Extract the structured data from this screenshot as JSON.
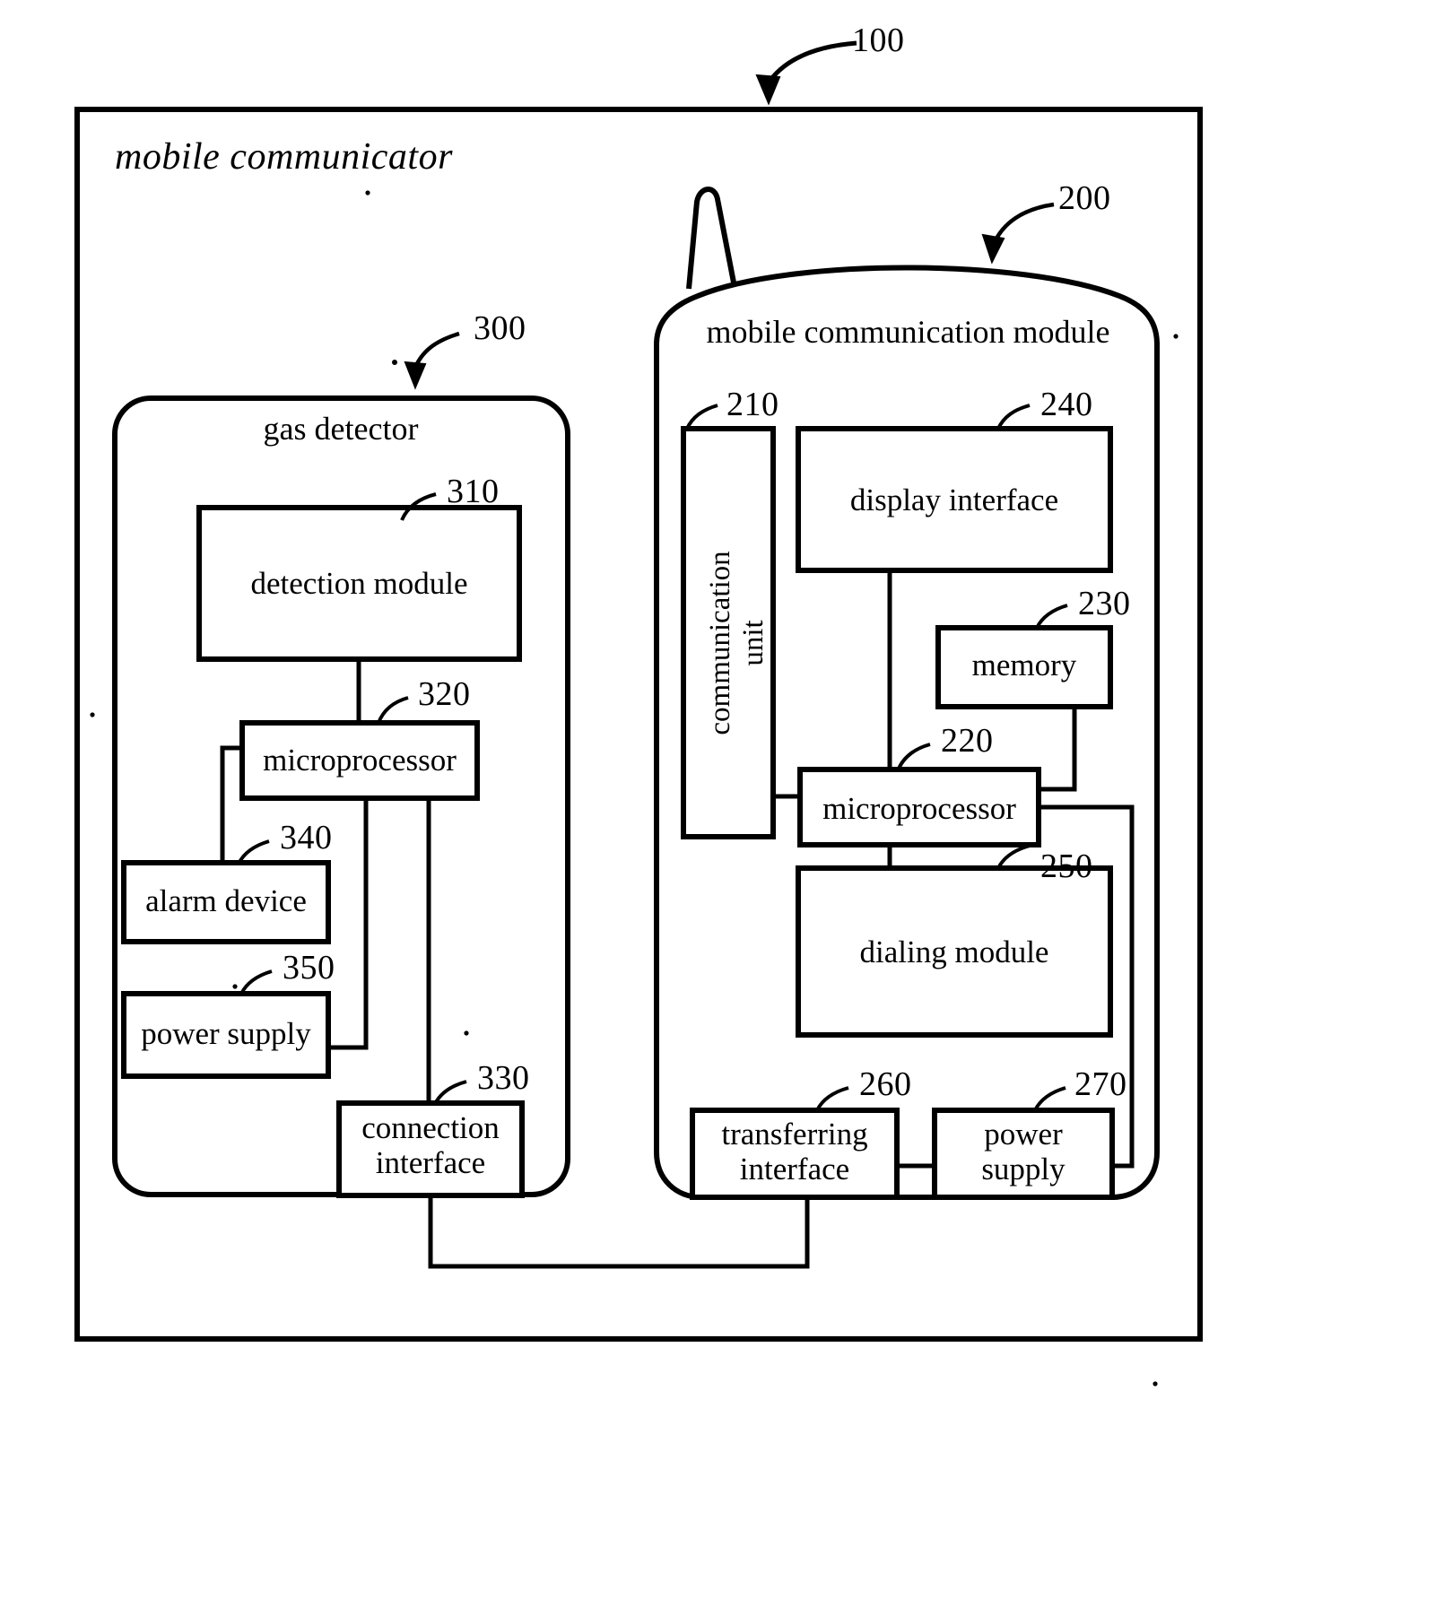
{
  "figure": {
    "root": {
      "title": "mobile communicator",
      "ref": "100"
    },
    "gas_detector": {
      "title": "gas detector",
      "ref": "300",
      "blocks": [
        {
          "label": "detection module",
          "ref": "310"
        },
        {
          "label": "microprocessor",
          "ref": "320"
        },
        {
          "label": "alarm device",
          "ref": "340"
        },
        {
          "label": "power supply",
          "ref": "350"
        },
        {
          "label": "connection\ninterface",
          "ref": "330"
        }
      ]
    },
    "mobile_module": {
      "title": "mobile communication module",
      "ref": "200",
      "blocks": [
        {
          "label": "communication\nunit",
          "ref": "210"
        },
        {
          "label": "display interface",
          "ref": "240"
        },
        {
          "label": "memory",
          "ref": "230"
        },
        {
          "label": "microprocessor",
          "ref": "220"
        },
        {
          "label": "dialing module",
          "ref": "250"
        },
        {
          "label": "transferring\ninterface",
          "ref": "260"
        },
        {
          "label": "power\nsupply",
          "ref": "270"
        }
      ]
    },
    "colors": {
      "line": "#000000",
      "background": "#ffffff"
    }
  }
}
